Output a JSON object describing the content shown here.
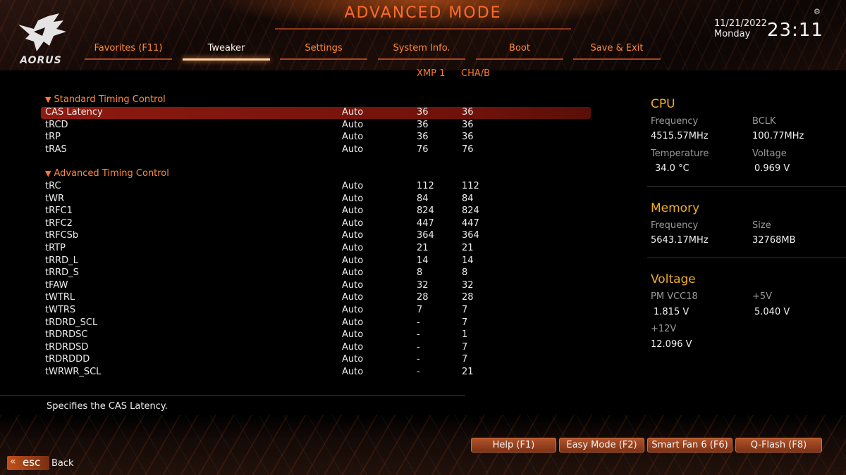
{
  "header": {
    "title": "ADVANCED MODE",
    "logo_text": "AORUS",
    "date": "11/21/2022",
    "day": "Monday",
    "time": "23:11",
    "settings_glyph": "⚙"
  },
  "tabs": [
    {
      "label": "Favorites (F11)",
      "active": false
    },
    {
      "label": "Tweaker",
      "active": true
    },
    {
      "label": "Settings",
      "active": false
    },
    {
      "label": "System Info.",
      "active": false
    },
    {
      "label": "Boot",
      "active": false
    },
    {
      "label": "Save & Exit",
      "active": false
    }
  ],
  "columns": {
    "xmp": "XMP 1",
    "cha": "CHA/B"
  },
  "sections": {
    "standard": "Standard Timing Control",
    "advanced": "Advanced Timing Control"
  },
  "standard_rows": [
    {
      "name": "CAS Latency",
      "setting": "Auto",
      "xmp": "36",
      "cha": "36"
    },
    {
      "name": "tRCD",
      "setting": "Auto",
      "xmp": "36",
      "cha": "36"
    },
    {
      "name": "tRP",
      "setting": "Auto",
      "xmp": "36",
      "cha": "36"
    },
    {
      "name": "tRAS",
      "setting": "Auto",
      "xmp": "76",
      "cha": "76"
    }
  ],
  "advanced_rows": [
    {
      "name": "tRC",
      "setting": "Auto",
      "xmp": "112",
      "cha": "112"
    },
    {
      "name": "tWR",
      "setting": "Auto",
      "xmp": "84",
      "cha": "84"
    },
    {
      "name": "tRFC1",
      "setting": "Auto",
      "xmp": "824",
      "cha": "824"
    },
    {
      "name": "tRFC2",
      "setting": "Auto",
      "xmp": "447",
      "cha": "447"
    },
    {
      "name": "tRFCSb",
      "setting": "Auto",
      "xmp": "364",
      "cha": "364"
    },
    {
      "name": "tRTP",
      "setting": "Auto",
      "xmp": "21",
      "cha": "21"
    },
    {
      "name": "tRRD_L",
      "setting": "Auto",
      "xmp": "14",
      "cha": "14"
    },
    {
      "name": "tRRD_S",
      "setting": "Auto",
      "xmp": "8",
      "cha": "8"
    },
    {
      "name": "tFAW",
      "setting": "Auto",
      "xmp": "32",
      "cha": "32"
    },
    {
      "name": "tWTRL",
      "setting": "Auto",
      "xmp": "28",
      "cha": "28"
    },
    {
      "name": "tWTRS",
      "setting": "Auto",
      "xmp": "7",
      "cha": "7"
    },
    {
      "name": "tRDRD_SCL",
      "setting": "Auto",
      "xmp": "-",
      "cha": "7"
    },
    {
      "name": "tRDRDSC",
      "setting": "Auto",
      "xmp": "-",
      "cha": "1"
    },
    {
      "name": "tRDRDSD",
      "setting": "Auto",
      "xmp": "-",
      "cha": "7"
    },
    {
      "name": "tRDRDDD",
      "setting": "Auto",
      "xmp": "-",
      "cha": "7"
    },
    {
      "name": "tWRWR_SCL",
      "setting": "Auto",
      "xmp": "-",
      "cha": "21"
    }
  ],
  "help_text": "Specifies the CAS Latency.",
  "info": {
    "cpu": {
      "title": "CPU",
      "freq_label": "Frequency",
      "freq": "4515.57MHz",
      "bclk_label": "BCLK",
      "bclk": "100.77MHz",
      "temp_label": "Temperature",
      "temp": "34.0 °C",
      "volt_label": "Voltage",
      "volt": "0.969 V"
    },
    "memory": {
      "title": "Memory",
      "freq_label": "Frequency",
      "freq": "5643.17MHz",
      "size_label": "Size",
      "size": "32768MB"
    },
    "voltage": {
      "title": "Voltage",
      "pm_label": "PM VCC18",
      "pm": "1.815 V",
      "p5_label": "+5V",
      "p5": "5.040 V",
      "p12_label": "+12V",
      "p12": "12.096 V"
    }
  },
  "footer": {
    "buttons": [
      "Help (F1)",
      "Easy Mode (F2)",
      "Smart Fan 6 (F6)",
      "Q-Flash (F8)"
    ],
    "esc_label": "esc",
    "esc_arrows": "«",
    "back_label": "Back"
  }
}
